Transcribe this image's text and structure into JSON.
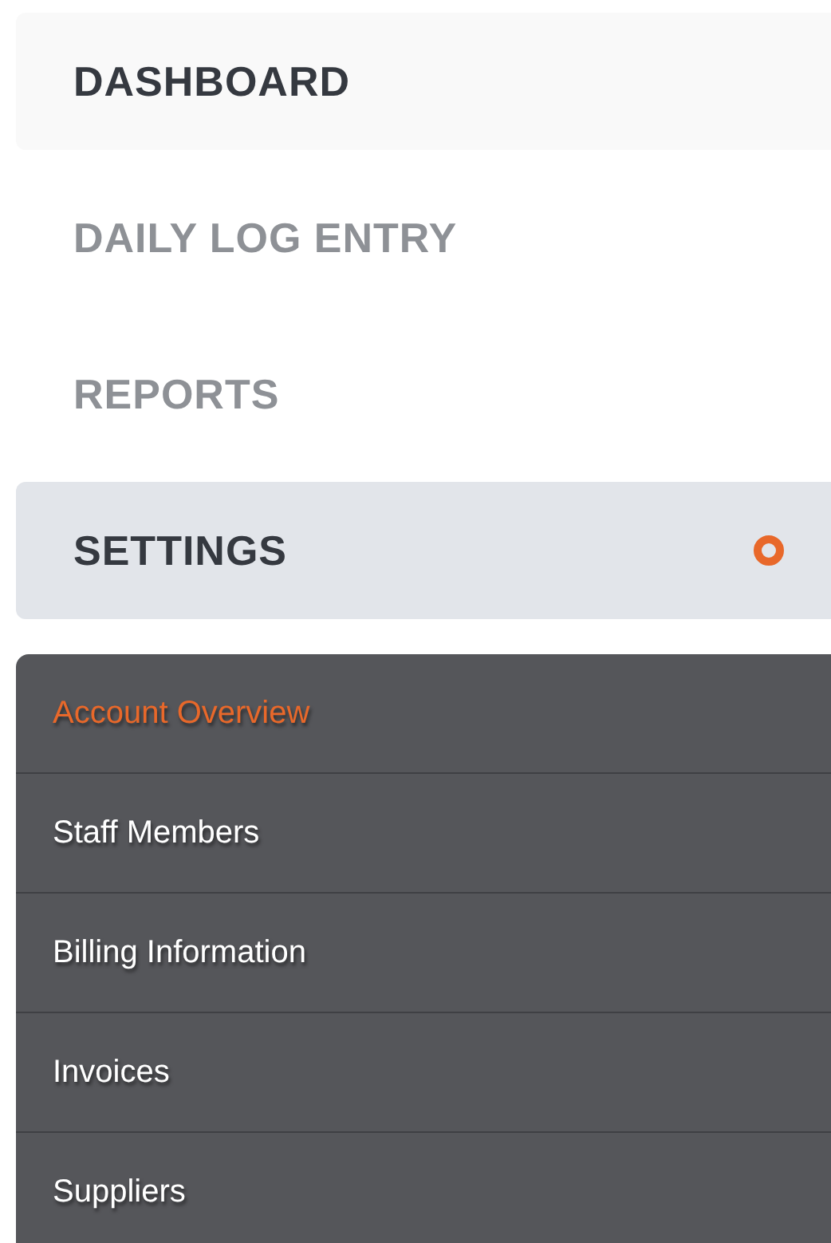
{
  "nav": {
    "items": [
      {
        "label": "DASHBOARD",
        "selected": false,
        "hovered": true
      },
      {
        "label": "DAILY LOG ENTRY",
        "selected": false,
        "hovered": false
      },
      {
        "label": "REPORTS",
        "selected": false,
        "hovered": false
      },
      {
        "label": "SETTINGS",
        "selected": true,
        "hovered": false
      }
    ]
  },
  "submenu": {
    "items": [
      {
        "label": "Account Overview",
        "selected": true
      },
      {
        "label": "Staff Members",
        "selected": false
      },
      {
        "label": "Billing Information",
        "selected": false
      },
      {
        "label": "Invoices",
        "selected": false
      },
      {
        "label": "Suppliers",
        "selected": false
      }
    ]
  }
}
